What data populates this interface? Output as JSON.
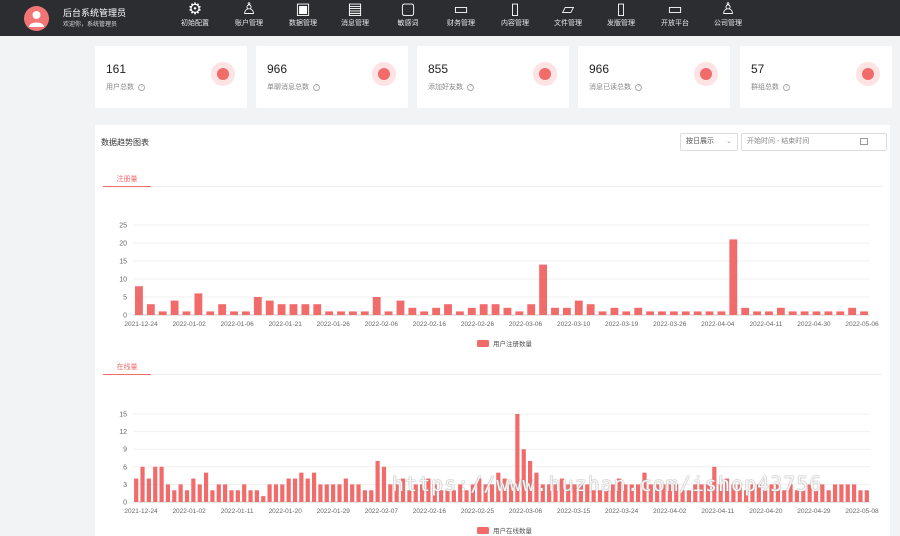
{
  "header": {
    "title": "后台系统管理员",
    "subtitle": "欢迎你，系统管理员",
    "nav": [
      {
        "label": "初始配置",
        "icon": "gear-icon"
      },
      {
        "label": "账户管理",
        "icon": "user-icon"
      },
      {
        "label": "数据管理",
        "icon": "database-icon"
      },
      {
        "label": "消息管理",
        "icon": "message-icon"
      },
      {
        "label": "敏感词",
        "icon": "lock-icon"
      },
      {
        "label": "财务管理",
        "icon": "wallet-icon"
      },
      {
        "label": "内容管理",
        "icon": "document-icon"
      },
      {
        "label": "文件管理",
        "icon": "folder-icon"
      },
      {
        "label": "发版管理",
        "icon": "file-icon"
      },
      {
        "label": "开放平台",
        "icon": "monitor-icon"
      },
      {
        "label": "公司管理",
        "icon": "users-icon"
      }
    ]
  },
  "stats": [
    {
      "value": "161",
      "label": "用户总数",
      "icon": "pie-chart-icon"
    },
    {
      "value": "966",
      "label": "单聊消息总数",
      "icon": "chat-icon"
    },
    {
      "value": "855",
      "label": "添加好友数",
      "icon": "person-icon"
    },
    {
      "value": "966",
      "label": "消息已读总数",
      "icon": "chat-icon"
    },
    {
      "value": "57",
      "label": "群组总数",
      "icon": "group-icon"
    }
  ],
  "panel": {
    "title": "数据趋势图表",
    "range_select": "按日展示",
    "date_placeholder": "开始时间 - 结束时间"
  },
  "chart_data": [
    {
      "type": "bar",
      "tab": "注册量",
      "legend": "用户注册数量",
      "color": "#f26b6b",
      "ylim": [
        0,
        25
      ],
      "yticks": [
        0,
        5,
        10,
        15,
        20,
        25
      ],
      "xticks": [
        "2021-12-24",
        "2022-01-02",
        "2022-01-06",
        "2022-01-21",
        "2022-01-26",
        "2022-02-06",
        "2022-02-16",
        "2022-02-26",
        "2022-03-06",
        "2022-03-10",
        "2022-03-19",
        "2022-03-26",
        "2022-04-04",
        "2022-04-11",
        "2022-04-30",
        "2022-05-06"
      ],
      "values": [
        8,
        3,
        1,
        4,
        1,
        6,
        1,
        3,
        1,
        1,
        5,
        4,
        3,
        3,
        3,
        3,
        1,
        1,
        1,
        1,
        5,
        1,
        4,
        2,
        1,
        2,
        3,
        1,
        2,
        3,
        3,
        2,
        1,
        3,
        14,
        2,
        2,
        4,
        3,
        1,
        2,
        1,
        2,
        1,
        1,
        1,
        1,
        1,
        1,
        1,
        21,
        2,
        1,
        1,
        2,
        1,
        1,
        1,
        1,
        1,
        2,
        1
      ]
    },
    {
      "type": "bar",
      "tab": "在线量",
      "legend": "用户在线数量",
      "color": "#f26b6b",
      "ylim": [
        0,
        15
      ],
      "yticks": [
        0,
        3,
        6,
        9,
        12,
        15
      ],
      "xticks": [
        "2021-12-24",
        "2022-01-02",
        "2022-01-11",
        "2022-01-20",
        "2022-01-29",
        "2022-02-07",
        "2022-02-16",
        "2022-02-25",
        "2022-03-06",
        "2022-03-15",
        "2022-03-24",
        "2022-04-02",
        "2022-04-11",
        "2022-04-20",
        "2022-04-29",
        "2022-05-08"
      ],
      "values": [
        4,
        6,
        4,
        6,
        6,
        3,
        2,
        3,
        2,
        4,
        3,
        5,
        2,
        3,
        3,
        2,
        2,
        3,
        2,
        2,
        1,
        3,
        3,
        3,
        4,
        4,
        5,
        4,
        5,
        3,
        3,
        3,
        3,
        4,
        3,
        3,
        2,
        2,
        7,
        6,
        3,
        3,
        4,
        2,
        3,
        3,
        4,
        3,
        2,
        2,
        2,
        3,
        2,
        3,
        4,
        3,
        3,
        5,
        4,
        3,
        15,
        9,
        7,
        5,
        3,
        3,
        3,
        4,
        3,
        3,
        3,
        3,
        2,
        2,
        2,
        3,
        4,
        3,
        3,
        3,
        5,
        3,
        3,
        3,
        3,
        3,
        2,
        2,
        3,
        3,
        3,
        6,
        3,
        4,
        3,
        3,
        2,
        3,
        3,
        2,
        3,
        3,
        2,
        3,
        2,
        2,
        3,
        2,
        3,
        2,
        3,
        3,
        3,
        3,
        2,
        2
      ]
    }
  ],
  "watermark": "https://www.huzhan.com/ishop43756"
}
